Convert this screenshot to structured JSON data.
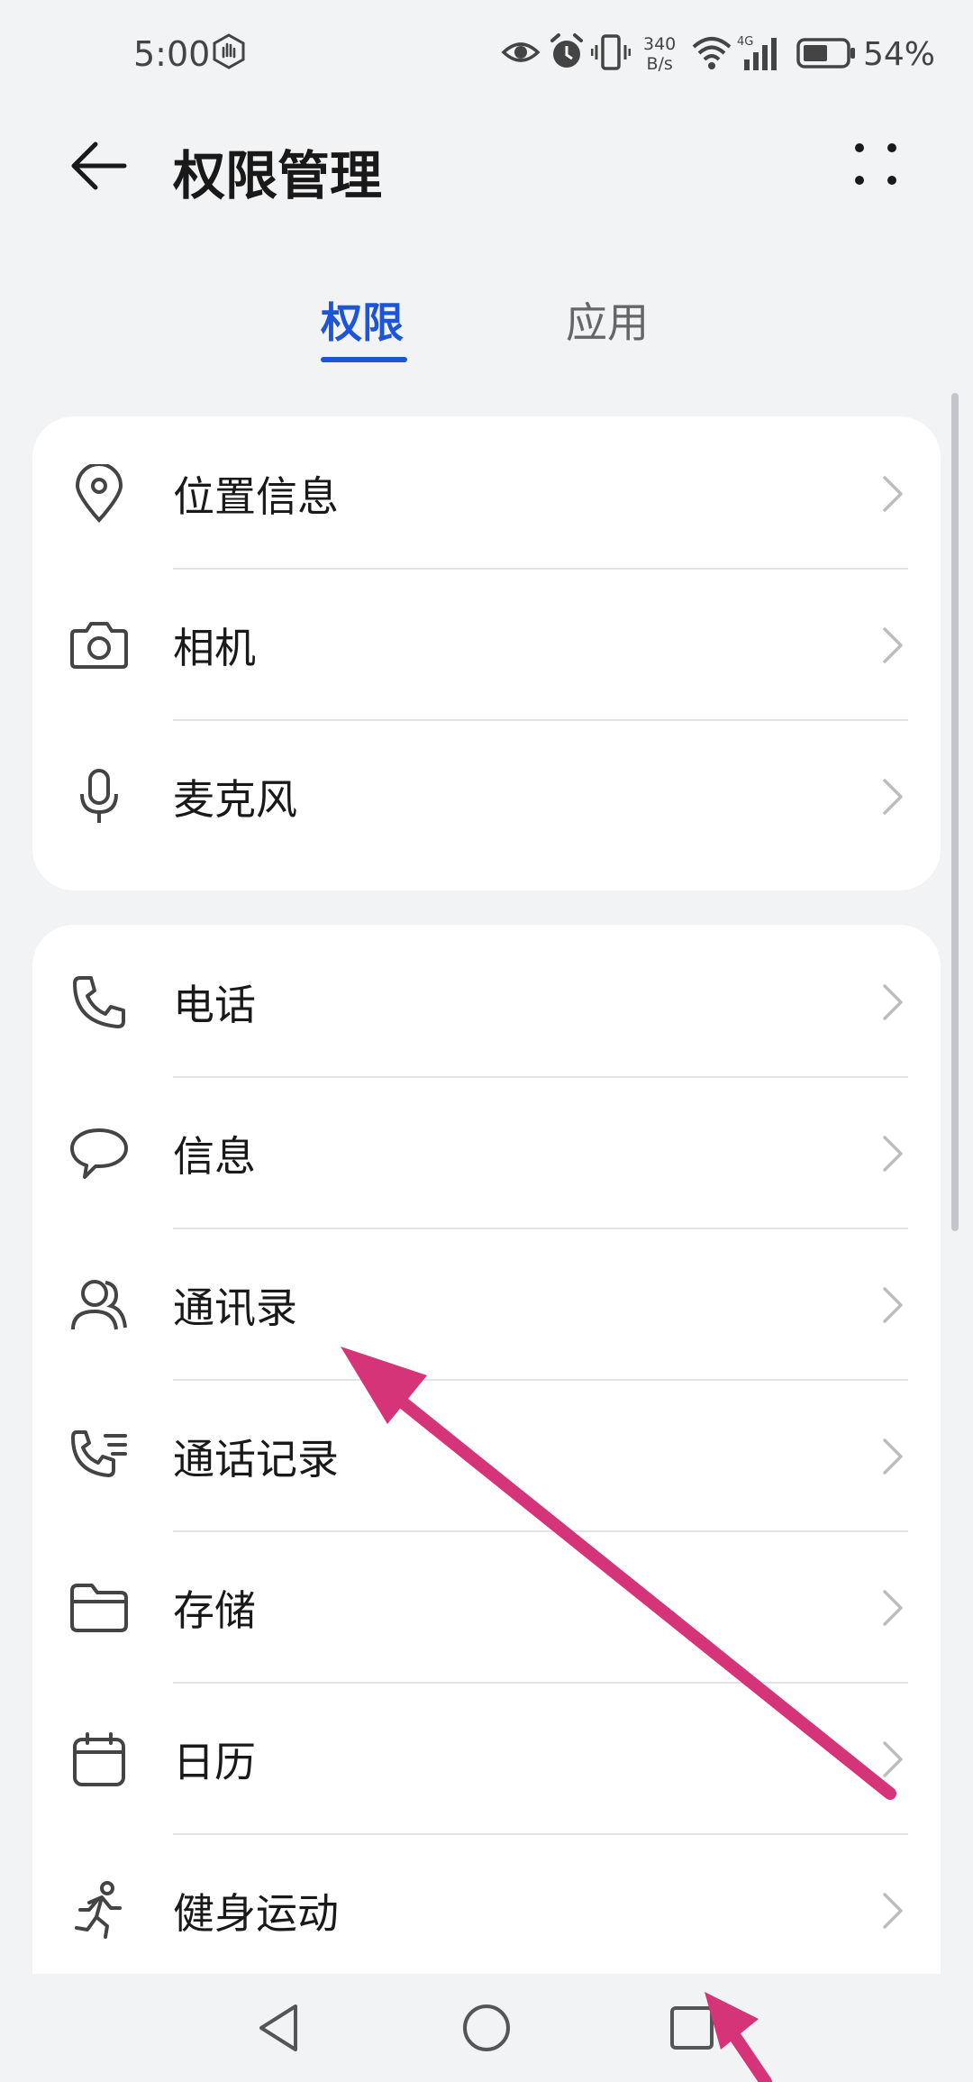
{
  "status_bar": {
    "time": "5:00",
    "net_speed_value": "340",
    "net_speed_unit": "B/s",
    "network_type": "4G",
    "battery_percent": "54%",
    "icons": [
      "hand-icon",
      "eye-icon",
      "alarm-icon",
      "vibrate-icon",
      "wifi-icon",
      "signal-icon",
      "battery-icon"
    ]
  },
  "header": {
    "title": "权限管理",
    "back_icon": "arrow-left-icon",
    "more_icon": "more-dots-icon"
  },
  "tabs": [
    {
      "label": "权限",
      "active": true
    },
    {
      "label": "应用",
      "active": false
    }
  ],
  "groups": [
    {
      "items": [
        {
          "label": "位置信息",
          "icon": "location-pin-icon"
        },
        {
          "label": "相机",
          "icon": "camera-icon"
        },
        {
          "label": "麦克风",
          "icon": "microphone-icon"
        }
      ]
    },
    {
      "items": [
        {
          "label": "电话",
          "icon": "phone-icon"
        },
        {
          "label": "信息",
          "icon": "message-bubble-icon"
        },
        {
          "label": "通讯录",
          "icon": "contacts-icon"
        },
        {
          "label": "通话记录",
          "icon": "call-log-icon"
        },
        {
          "label": "存储",
          "icon": "folder-icon"
        },
        {
          "label": "日历",
          "icon": "calendar-icon"
        },
        {
          "label": "健身运动",
          "icon": "running-icon"
        }
      ]
    }
  ],
  "colors": {
    "accent": "#1d55d9",
    "background": "#f1f3f5",
    "card": "#ffffff",
    "annotation_arrow": "#d63478"
  },
  "nav_bar": {
    "icons": [
      "back-triangle-icon",
      "home-circle-icon",
      "recents-square-icon"
    ]
  }
}
